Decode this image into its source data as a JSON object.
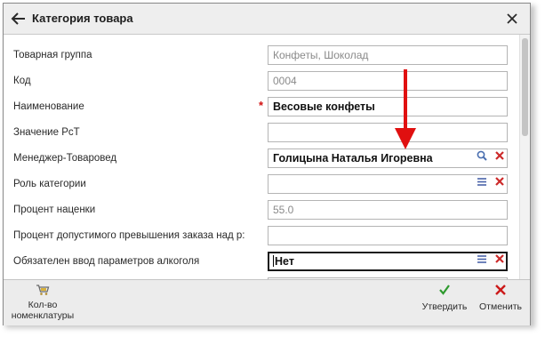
{
  "dialog": {
    "title": "Категория товара"
  },
  "fields": [
    {
      "label": "Товарная группа",
      "value": "Конфеты, Шоколад",
      "readonly": true
    },
    {
      "label": "Код",
      "value": "0004",
      "readonly": true
    },
    {
      "label": "Наименование",
      "value": "Весовые конфеты",
      "required": "*"
    },
    {
      "label": "Значение РсТ",
      "value": ""
    },
    {
      "label": "Менеджер-Товаровед",
      "value": "Голицына Наталья Игоревна"
    },
    {
      "label": "Роль категории",
      "value": ""
    },
    {
      "label": "Процент наценки",
      "value": "55.0",
      "readonly": true
    },
    {
      "label": "Процент допустимого превышения заказа над р:",
      "value": ""
    },
    {
      "label": "Обязателен ввод параметров алкоголя",
      "value": "Нет"
    }
  ],
  "footer": {
    "nomenclature_label_line1": "Кол-во",
    "nomenclature_label_line2": "номенклатуры",
    "confirm_label": "Утвердить",
    "cancel_label": "Отменить"
  },
  "colors": {
    "required": "#d21010",
    "confirm": "#2e9a2e",
    "cancel": "#cc1a1a",
    "annotation_arrow": "#e01010",
    "clear_icon": "#cc2a2a",
    "list_icon": "#4a63a8"
  },
  "icons": [
    "back-arrow-icon",
    "close-icon",
    "search-icon",
    "clear-icon",
    "list-icon",
    "cart-icon",
    "checkmark-icon",
    "cross-icon"
  ]
}
